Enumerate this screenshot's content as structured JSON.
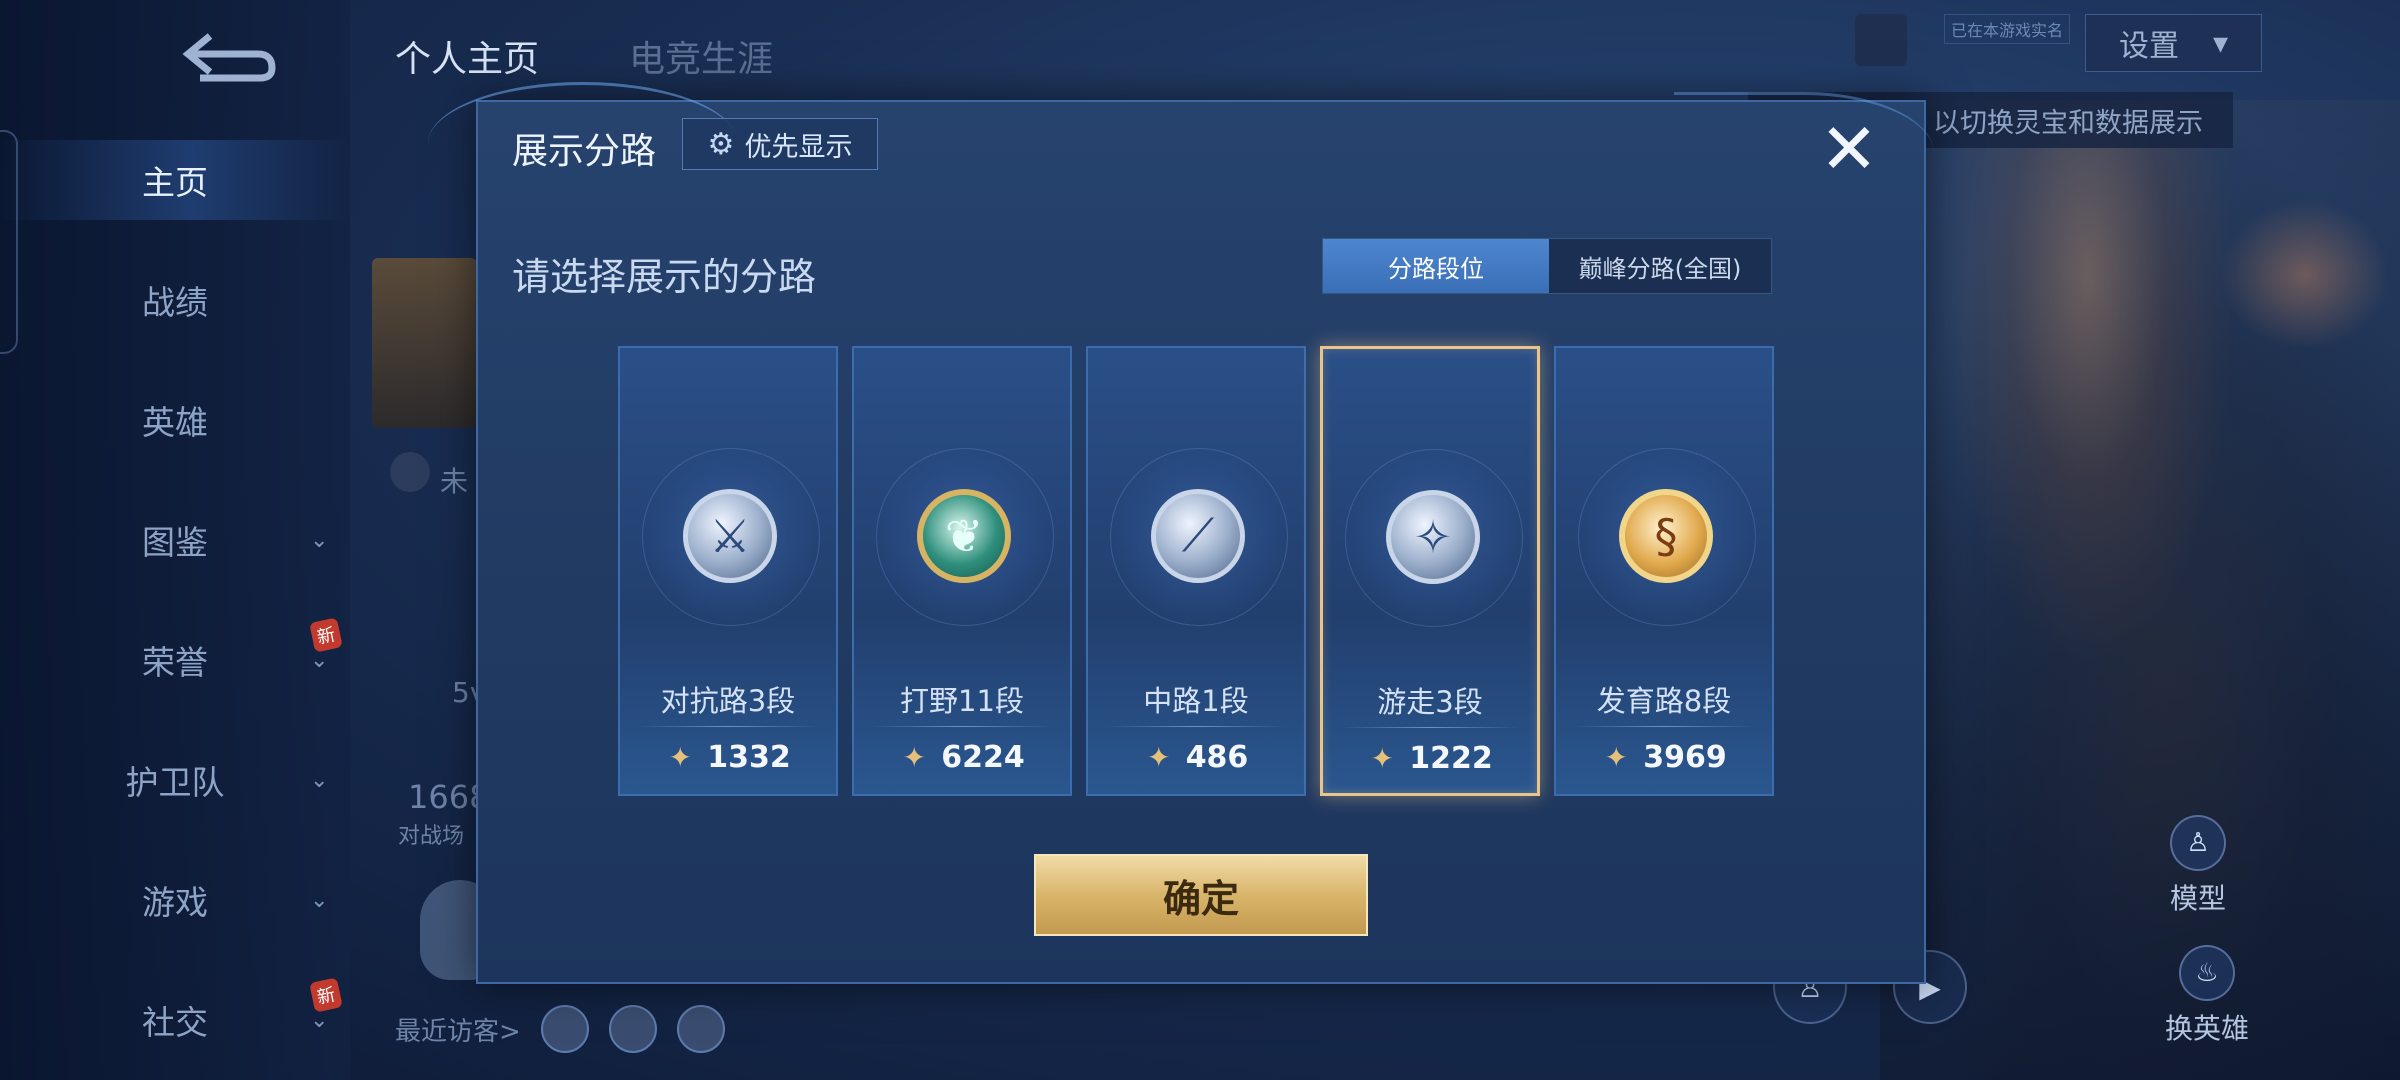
{
  "sidebar": {
    "items": [
      {
        "label": "主页"
      },
      {
        "label": "战绩"
      },
      {
        "label": "英雄"
      },
      {
        "label": "图鉴"
      },
      {
        "label": "荣誉"
      },
      {
        "label": "护卫队"
      },
      {
        "label": "游戏"
      },
      {
        "label": "社交"
      }
    ],
    "new_badge": "新"
  },
  "header": {
    "tabs": [
      "个人主页",
      "电竞生涯"
    ],
    "verify_tag": "已在本游戏实名",
    "settings_label": "设置",
    "tip": "以切换灵宝和数据展示"
  },
  "background": {
    "visitors_label": "最近访客>",
    "partial_stat_value": "1668",
    "partial_stat_label": "对战场",
    "partial_text_1": "未",
    "partial_text_2": "5v",
    "model_label": "模型",
    "switch_hero_label": "换英雄"
  },
  "modal": {
    "title": "展示分路",
    "priority_label": "优先显示",
    "subtitle": "请选择展示的分路",
    "toggle": {
      "option1": "分路段位",
      "option2": "巅峰分路(全国)"
    },
    "lanes": [
      {
        "label": "对抗路3段",
        "score": "1332",
        "emblem": "crossed-swords-icon",
        "style": "silver",
        "selected": false
      },
      {
        "label": "打野11段",
        "score": "6224",
        "emblem": "dragon-icon",
        "style": "jade",
        "selected": false
      },
      {
        "label": "中路1段",
        "score": "486",
        "emblem": "wand-icon",
        "style": "silver",
        "selected": false
      },
      {
        "label": "游走3段",
        "score": "1222",
        "emblem": "wings-icon",
        "style": "silver",
        "selected": true
      },
      {
        "label": "发育路8段",
        "score": "3969",
        "emblem": "bow-icon",
        "style": "gold",
        "selected": false
      }
    ],
    "confirm_label": "确定"
  },
  "colors": {
    "accent_gold": "#e9c48b",
    "toggle_active": "#4e86cf"
  }
}
